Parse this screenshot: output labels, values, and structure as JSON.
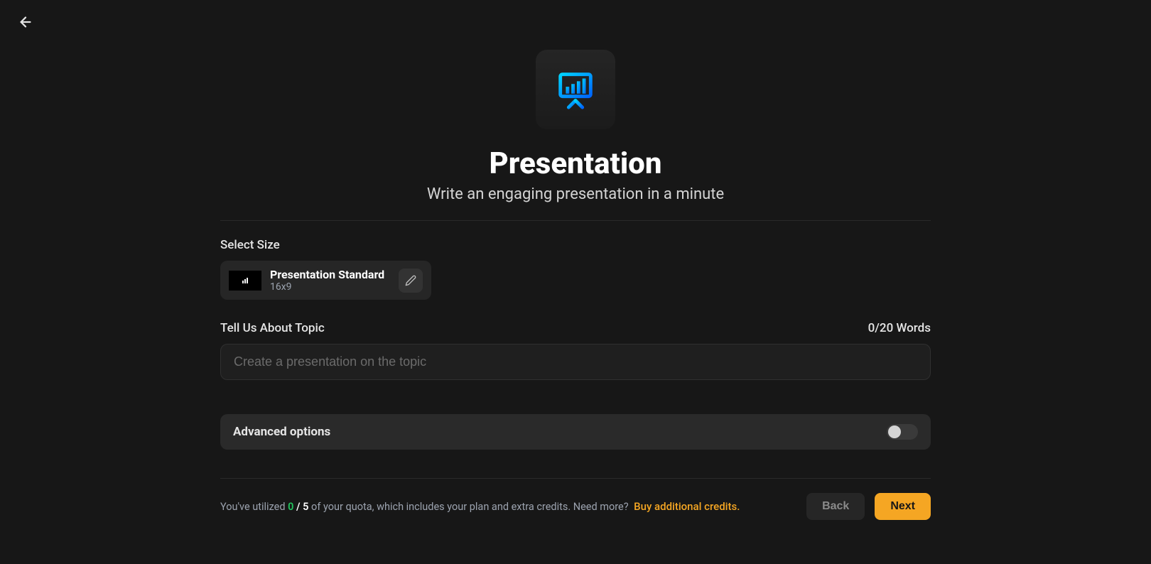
{
  "header": {
    "title": "Presentation",
    "subtitle": "Write an engaging presentation in a minute"
  },
  "size": {
    "section_label": "Select Size",
    "name": "Presentation Standard",
    "ratio": "16x9"
  },
  "topic": {
    "section_label": "Tell Us About Topic",
    "word_count": "0/20 Words",
    "placeholder": "Create a presentation on the topic",
    "value": ""
  },
  "advanced": {
    "label": "Advanced options",
    "enabled": false
  },
  "quota": {
    "prefix": "You've utilized ",
    "used": "0",
    "slash": " / ",
    "total": "5",
    "suffix": " of your quota, which includes your plan and extra credits. Need more? ",
    "buy_link": "Buy additional credits."
  },
  "nav": {
    "back_label": "Back",
    "next_label": "Next"
  }
}
